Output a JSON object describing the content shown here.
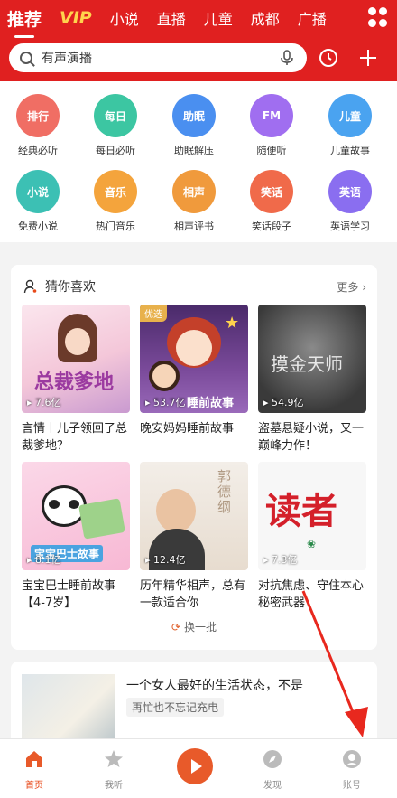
{
  "header": {
    "tabs": [
      "推荐",
      "VIP",
      "小说",
      "直播",
      "儿童",
      "成都",
      "广播"
    ],
    "active_tab": "推荐",
    "search_placeholder": "有声演播"
  },
  "categories": [
    {
      "icon_text": "排行",
      "label": "经典必听",
      "color": "#f06e64"
    },
    {
      "icon_text": "每日",
      "label": "每日必听",
      "color": "#3cc6a2"
    },
    {
      "icon_text": "助眠",
      "label": "助眠解压",
      "color": "#4a8ff0"
    },
    {
      "icon_text": "FM",
      "label": "随便听",
      "color": "#a06ef0"
    },
    {
      "icon_text": "儿童",
      "label": "儿童故事",
      "color": "#4aa3f0"
    },
    {
      "icon_text": "小说",
      "label": "免费小说",
      "color": "#3cc0b4"
    },
    {
      "icon_text": "音乐",
      "label": "热门音乐",
      "color": "#f4a43c"
    },
    {
      "icon_text": "相声",
      "label": "相声评书",
      "color": "#f09a3c"
    },
    {
      "icon_text": "笑话",
      "label": "笑话段子",
      "color": "#f06a4a"
    },
    {
      "icon_text": "英语",
      "label": "英语学习",
      "color": "#8a6ef0"
    }
  ],
  "recommend": {
    "title": "猜你喜欢",
    "more": "更多 ›",
    "refresh": "换一批",
    "items": [
      {
        "title": "言情丨儿子领回了总裁爹地？",
        "plays": "7.6亿",
        "cover_text": "总裁爹地",
        "badge": ""
      },
      {
        "title": "晚安妈妈睡前故事",
        "plays": "53.7亿",
        "cover_text": "睡前故事",
        "badge": "优选"
      },
      {
        "title": "盗墓悬疑小说，又一巅峰力作！",
        "plays": "54.9亿",
        "cover_text": "摸金天师",
        "badge": ""
      },
      {
        "title": "宝宝巴士睡前故事【4-7岁】",
        "plays": "8.1亿",
        "cover_text": "宝宝巴士故事",
        "badge": ""
      },
      {
        "title": "历年精华相声，总有一款适合你",
        "plays": "12.4亿",
        "cover_text": "郭德纲",
        "badge": ""
      },
      {
        "title": "对抗焦虑、守住本心秘密武器",
        "plays": "7.3亿",
        "cover_text": "读者",
        "badge": ""
      }
    ]
  },
  "article": {
    "title": "一个女人最好的生活状态，不是",
    "tag": "再忙也不忘记充电"
  },
  "nav": [
    "首页",
    "我听",
    "发现",
    "账号"
  ]
}
